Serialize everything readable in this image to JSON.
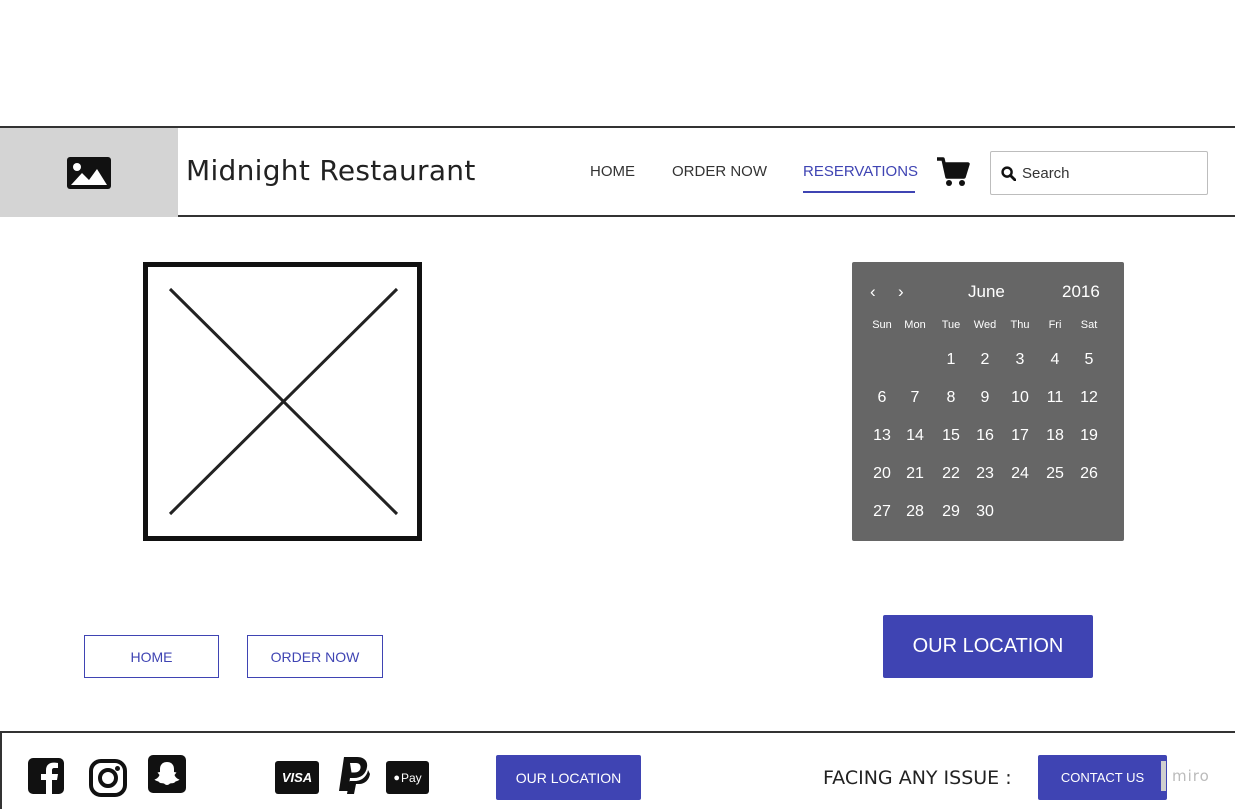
{
  "header": {
    "brand": "Midnight Restaurant",
    "nav": [
      "HOME",
      "ORDER NOW",
      "RESERVATIONS"
    ],
    "active_nav": "RESERVATIONS",
    "search_placeholder": "Search"
  },
  "calendar": {
    "month": "June",
    "year": "2016",
    "prev": "‹",
    "next": "›",
    "weekdays": [
      "Sun",
      "Mon",
      "Tue",
      "Wed",
      "Thu",
      "Fri",
      "Sat"
    ],
    "first_weekday_index": 2,
    "days_in_month": 30
  },
  "main": {
    "home_button": "HOME",
    "order_button": "ORDER NOW",
    "location_button": "OUR LOCATION"
  },
  "footer": {
    "social_icons": [
      "facebook-icon",
      "instagram-icon",
      "snapchat-icon"
    ],
    "payment": {
      "visa": "VISA",
      "paypal": "P",
      "applepay": "Pay"
    },
    "location_button": "OUR LOCATION",
    "issue_text": "FACING ANY ISSUE :",
    "contact_button": "CONTACT US",
    "watermark": "miro"
  },
  "colors": {
    "accent": "#3f44b3",
    "calendar_bg": "#666666",
    "logo_bg": "#d4d4d4"
  }
}
